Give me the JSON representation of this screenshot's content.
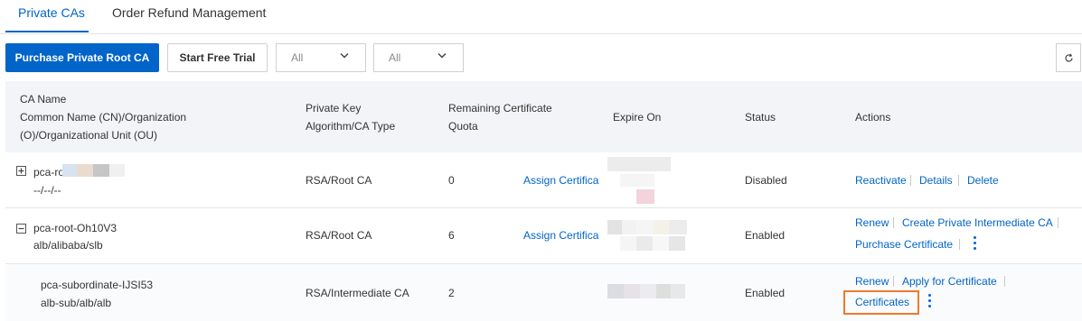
{
  "tabs": [
    {
      "label": "Private CAs",
      "active": true
    },
    {
      "label": "Order Refund Management",
      "active": false
    }
  ],
  "toolbar": {
    "purchase_label": "Purchase Private Root CA",
    "trial_label": "Start Free Trial",
    "filter1_value": "All",
    "filter2_value": "All"
  },
  "colors": {
    "accent": "#0064c8",
    "highlight": "#ef7a2e",
    "header_bg": "#f2f4f7"
  },
  "table": {
    "headers": {
      "ca_name_line1": "CA Name",
      "ca_name_line2": "Common Name (CN)/Organization",
      "ca_name_line3": "(O)/Organizational Unit (OU)",
      "algo_line1": "Private Key",
      "algo_line2": "Algorithm/CA Type",
      "quota_line1": "Remaining Certificate",
      "quota_line2": "Quota",
      "expire": "Expire On",
      "status": "Status",
      "actions": "Actions"
    },
    "rows": [
      {
        "name": "pca-ro",
        "org": "--/--/--",
        "algo": "RSA/Root CA",
        "quota": "0",
        "assign": "Assign Certifica",
        "status": "Disabled",
        "actions": [
          "Reactivate",
          "Details",
          "Delete"
        ]
      },
      {
        "name": "pca-root-Oh10V3",
        "org": "alb/alibaba/slb",
        "algo": "RSA/Root CA",
        "quota": "6",
        "assign": "Assign Certifica",
        "status": "Enabled",
        "actions": [
          "Renew",
          "Create Private Intermediate CA",
          "Purchase Certificate"
        ]
      },
      {
        "name": "pca-subordinate-IJSI53",
        "org": "alb-sub/alb/alb",
        "algo": "RSA/Intermediate CA",
        "quota": "2",
        "status": "Enabled",
        "actions": [
          "Renew",
          "Apply for Certificate",
          "Certificates"
        ]
      }
    ]
  },
  "icons": {
    "refresh": "refresh-icon",
    "expand": "plus-square-icon",
    "collapse": "minus-square-icon",
    "more": "more-vertical-icon",
    "dropdown": "chevron-down-icon"
  }
}
